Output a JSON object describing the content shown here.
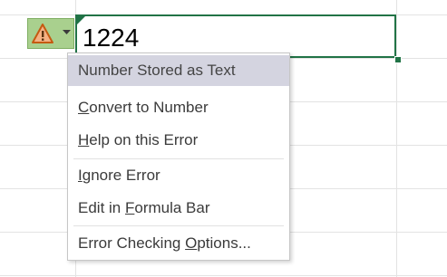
{
  "cell": {
    "value": "1224"
  },
  "error_button": {
    "icon": "warning-triangle-icon",
    "dropdown_icon": "chevron-down-icon"
  },
  "menu": {
    "header": "Number Stored as Text",
    "convert": {
      "mnemonic": "C",
      "rest": "onvert to Number"
    },
    "help": {
      "mnemonic": "H",
      "rest": "elp on this Error"
    },
    "ignore": {
      "mnemonic": "I",
      "rest": "gnore Error"
    },
    "edit": {
      "before": "Edit in ",
      "mnemonic": "F",
      "after": "ormula Bar"
    },
    "options": {
      "before": "Error Checking ",
      "mnemonic": "O",
      "after": "ptions..."
    }
  },
  "colors": {
    "selection_border": "#217346",
    "error_indicator": "#1e7145",
    "error_button_bg": "#a9d08e",
    "warning_fill": "#f4b183",
    "warning_stroke": "#c55a11",
    "menu_header_bg": "#d4d4e0"
  }
}
